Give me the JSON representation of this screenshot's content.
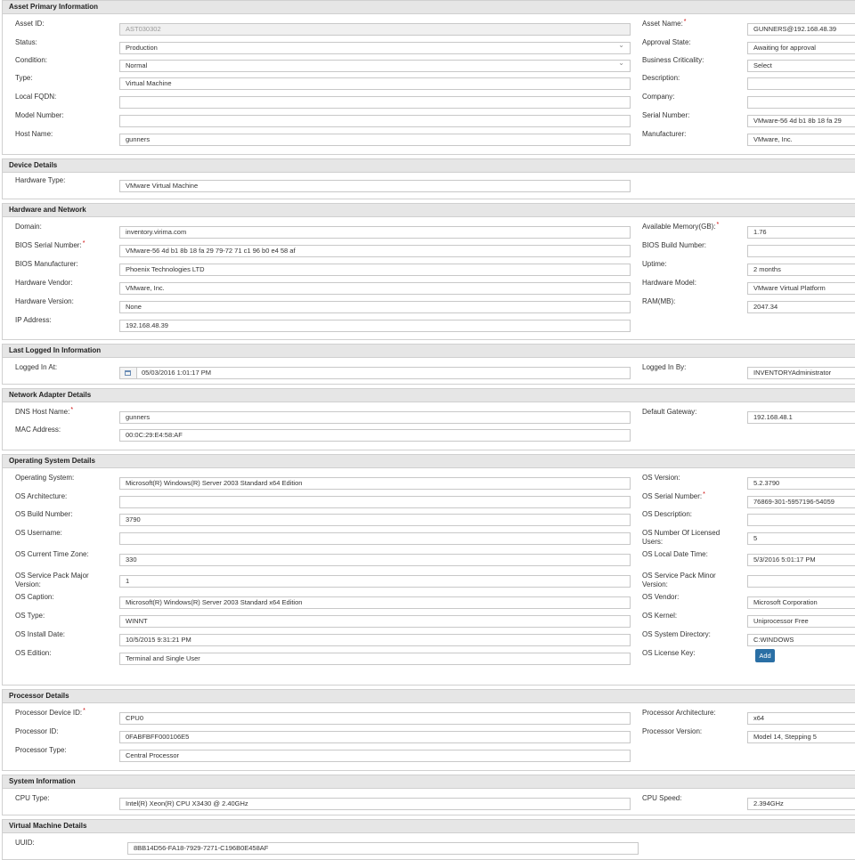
{
  "colors": {
    "section_header": "#e6e6e6",
    "field_border": "#c8c8c8",
    "disabled_field": "#f0f0f0",
    "add_button": "#2a6fa5"
  },
  "icons": {
    "date_picker": "calendar-icon",
    "dropdown": "chevron-down-icon"
  },
  "sections": [
    {
      "title": "Asset Primary Information",
      "fields": [
        {
          "label": "Asset ID:",
          "value": "AST030302",
          "disabled": true
        },
        {
          "label": "Asset Name:",
          "value": "GUNNERS@192.168.48.39",
          "required": true
        },
        {
          "label": "Status:",
          "value": "Production",
          "select": true
        },
        {
          "label": "Approval State:",
          "value": "Awaiting for approval"
        },
        {
          "label": "Condition:",
          "value": "Normal",
          "select": true
        },
        {
          "label": "Business Criticality:",
          "value": "Select"
        },
        {
          "label": "Type:",
          "value": "Virtual Machine"
        },
        {
          "label": "Description:",
          "value": ""
        },
        {
          "label": "Local FQDN:",
          "value": ""
        },
        {
          "label": "Company:",
          "value": ""
        },
        {
          "label": "Model Number:",
          "value": ""
        },
        {
          "label": "Serial Number:",
          "value": "VMware-56 4d b1 8b 18 fa 29"
        },
        {
          "label": "Host Name:",
          "value": "gunners"
        },
        {
          "label": "Manufacturer:",
          "value": "VMware, Inc."
        }
      ]
    },
    {
      "title": "Device Details",
      "fields": [
        {
          "label": "Hardware Type:",
          "value": "VMware Virtual Machine"
        }
      ]
    },
    {
      "title": "Hardware and Network",
      "fields": [
        {
          "label": "Domain:",
          "value": "inventory.virima.com"
        },
        {
          "label": "Available Memory(GB):",
          "value": "1.76",
          "required": true
        },
        {
          "label": "BIOS Serial Number:",
          "value": "VMware-56 4d b1 8b 18 fa 29 79-72 71 c1 96 b0 e4 58 af",
          "required": true
        },
        {
          "label": "BIOS Build Number:",
          "value": ""
        },
        {
          "label": "BIOS Manufacturer:",
          "value": "Phoenix Technologies LTD"
        },
        {
          "label": "Uptime:",
          "value": "2 months"
        },
        {
          "label": "Hardware Vendor:",
          "value": "VMware, Inc."
        },
        {
          "label": "Hardware Model:",
          "value": "VMware Virtual Platform"
        },
        {
          "label": "Hardware Version:",
          "value": "None"
        },
        {
          "label": "RAM(MB):",
          "value": "2047.34"
        },
        {
          "label": "IP Address:",
          "value": "192.168.48.39"
        }
      ]
    },
    {
      "title": "Last Logged In Information",
      "fields": [
        {
          "label": "Logged In At:",
          "value": "05/03/2016 1:01:17 PM",
          "date": true
        },
        {
          "label": "Logged In By:",
          "value": "INVENTORYAdministrator"
        }
      ]
    },
    {
      "title": "Network Adapter Details",
      "fields": [
        {
          "label": "DNS Host Name:",
          "value": "gunners",
          "required": true
        },
        {
          "label": "Default Gateway:",
          "value": "192.168.48.1"
        },
        {
          "label": "MAC Address:",
          "value": "00:0C:29:E4:58:AF"
        }
      ]
    },
    {
      "title": "Operating System Details",
      "fields": [
        {
          "label": "Operating System:",
          "value": "Microsoft(R) Windows(R) Server 2003 Standard x64 Edition"
        },
        {
          "label": "OS Version:",
          "value": "5.2.3790"
        },
        {
          "label": "OS Architecture:",
          "value": ""
        },
        {
          "label": "OS Serial Number:",
          "value": "76869-301-5957196-54059",
          "required": true
        },
        {
          "label": "OS Build Number:",
          "value": "3790"
        },
        {
          "label": "OS Description:",
          "value": ""
        },
        {
          "label": "OS Username:",
          "value": ""
        },
        {
          "label": "OS Number Of Licensed Users:",
          "value": "5"
        },
        {
          "label": "OS Current Time Zone:",
          "value": "330"
        },
        {
          "label": "OS Local Date Time:",
          "value": "5/3/2016 5:01:17 PM"
        },
        {
          "label": "OS Service Pack Major Version:",
          "value": "1"
        },
        {
          "label": "OS Service Pack Minor Version:",
          "value": ""
        },
        {
          "label": "OS Caption:",
          "value": "Microsoft(R) Windows(R) Server 2003 Standard x64 Edition"
        },
        {
          "label": "OS Vendor:",
          "value": "Microsoft Corporation"
        },
        {
          "label": "OS Type:",
          "value": "WINNT"
        },
        {
          "label": "OS Kernel:",
          "value": "Uniprocessor Free"
        },
        {
          "label": "OS Install Date:",
          "value": "10/5/2015 9:31:21 PM"
        },
        {
          "label": "OS System Directory:",
          "value": "C:WINDOWS"
        },
        {
          "label": "OS Edition:",
          "value": "Terminal and Single User"
        },
        {
          "label": "OS License Key:",
          "button": "Add"
        }
      ]
    },
    {
      "title": "Processor Details",
      "fields": [
        {
          "label": "Processor Device ID:",
          "value": "CPU0",
          "required": true
        },
        {
          "label": "Processor Architecture:",
          "value": "x64"
        },
        {
          "label": "Processor ID:",
          "value": "0FABFBFF000106E5"
        },
        {
          "label": "Processor Version:",
          "value": "Model 14, Stepping 5"
        },
        {
          "label": "Processor Type:",
          "value": "Central Processor"
        }
      ]
    },
    {
      "title": "System Information",
      "fields": [
        {
          "label": "CPU Type:",
          "value": "Intel(R) Xeon(R) CPU        X3430  @ 2.40GHz"
        },
        {
          "label": "CPU Speed:",
          "value": "2.394GHz"
        }
      ]
    },
    {
      "title": "Virtual Machine Details",
      "fields": [
        {
          "label": "UUID:",
          "value": "8BB14D56-FA18-7929-7271-C196B0E458AF"
        }
      ]
    }
  ]
}
